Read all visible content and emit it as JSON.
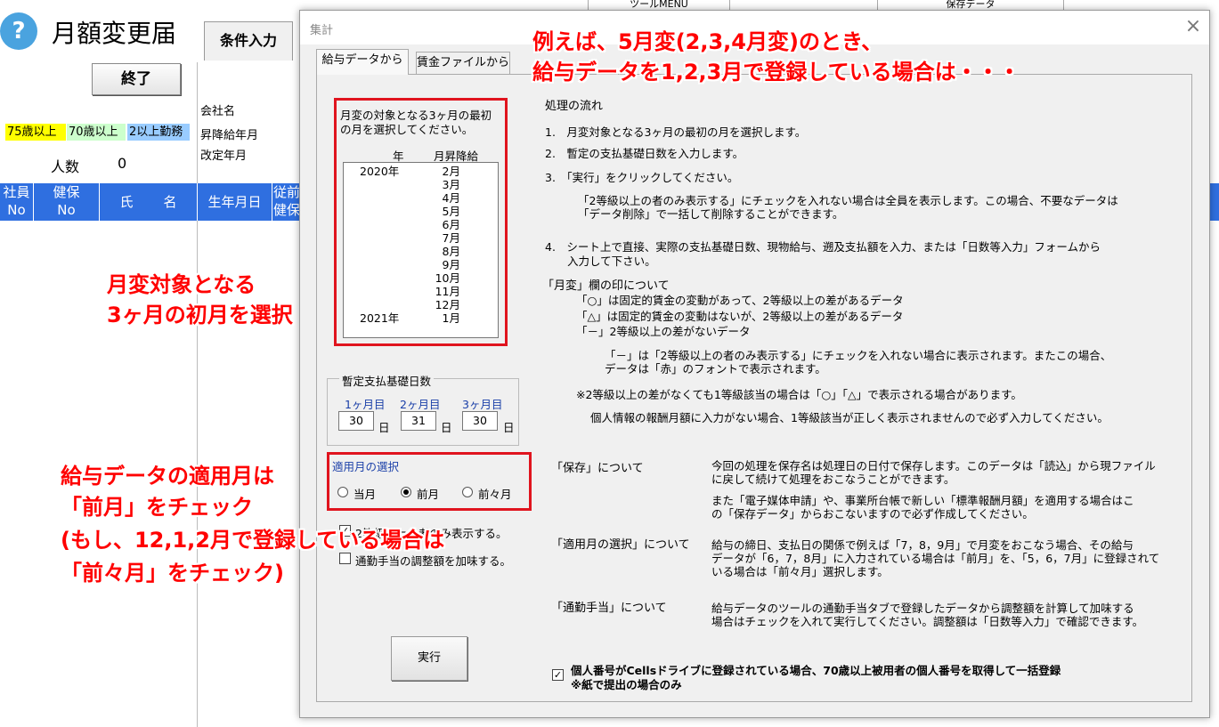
{
  "background": {
    "title": "月額変更届",
    "help_icon": "?",
    "end_button": "終了",
    "tab_condition": "条件入力",
    "top_tab_left": "ツールMENU",
    "top_tab_right": "保存データ",
    "company_label": "会社名",
    "raise_label": "昇降給年月",
    "revision_label": "改定年月",
    "badge_75": "75歳以上",
    "badge_70": "70歳以上",
    "badge_2": "2以上勤務",
    "count_label": "人数",
    "count_value": "0",
    "headers": [
      "社員",
      "No",
      "健保",
      "No",
      "氏",
      "名",
      "生年月日",
      "従前",
      "健保"
    ],
    "colors": {
      "header_bg": "#2f6fe0",
      "badge_75": "#ffff00",
      "badge_70": "#ccffcc",
      "badge_2": "#99ccff"
    }
  },
  "dialog": {
    "title": "集計",
    "close_icon": "×",
    "tabs": [
      "給与データから",
      "賃金ファイルから"
    ],
    "month_prompt": "月変の対象となる3ヶ月の最初の月を選択してください。",
    "col_year": "年",
    "col_month": "月昇降給",
    "month_list": [
      {
        "year": "2020年",
        "month": "2月"
      },
      {
        "year": "",
        "month": "3月"
      },
      {
        "year": "",
        "month": "4月"
      },
      {
        "year": "",
        "month": "5月"
      },
      {
        "year": "",
        "month": "6月"
      },
      {
        "year": "",
        "month": "7月"
      },
      {
        "year": "",
        "month": "8月"
      },
      {
        "year": "",
        "month": "9月"
      },
      {
        "year": "",
        "month": "10月"
      },
      {
        "year": "",
        "month": "11月"
      },
      {
        "year": "",
        "month": "12月"
      },
      {
        "year": "2021年",
        "month": "1月"
      }
    ],
    "days_group": "暫定支払基礎日数",
    "day_labels": [
      "1ヶ月目",
      "2ヶ月目",
      "3ヶ月目"
    ],
    "day_values": [
      "30",
      "31",
      "30"
    ],
    "day_unit": "日",
    "apply_title": "適用月の選択",
    "apply_options": [
      "当月",
      "前月",
      "前々月"
    ],
    "apply_selected": "前月",
    "check_grade2": "2等級以上の者のみ表示する。",
    "check_commute": "通勤手当の調整額を加味する。",
    "exec_button": "実行",
    "flow_title": "処理の流れ",
    "flow_1": "1.　月変対象となる3ヶ月の最初の月を選択します。",
    "flow_2": "2.　暫定の支払基礎日数を入力します。",
    "flow_3": "3.　「実行」をクリックしてください。",
    "flow_3_note_1": "「2等級以上の者のみ表示する」にチェックを入れない場合は全員を表示します。この場合、不要なデータは",
    "flow_3_note_2": "「データ削除」で一括して削除することができます。",
    "flow_4_1": "4.　シート上で直接、実際の支払基礎日数、現物給与、遡及支払額を入力、または「日数等入力」フォームから",
    "flow_4_2": "入力して下さい。",
    "mark_title": "「月変」欄の印について",
    "mark_1": "「○」は固定的賃金の変動があって、2等級以上の差があるデータ",
    "mark_2": "「△」は固定的賃金の変動はないが、2等級以上の差があるデータ",
    "mark_3": "「－」2等級以上の差がないデータ",
    "mark_note_1": "「－」は「2等級以上の者のみ表示する」にチェックを入れない場合に表示されます。またこの場合、",
    "mark_note_2": "データは「赤」のフォントで表示されます。",
    "note_star": "※2等級以上の差がなくても1等級該当の場合は「○」「△」で表示される場合があります。",
    "note_personal": "個人情報の報酬月額に入力がない場合、1等級該当が正しく表示されませんので必ず入力してください。",
    "save_label": "「保存」について",
    "save_1": "今回の処理を保存名は処理日の日付で保存します。このデータは「読込」から現ファイル",
    "save_2": "に戻して続けて処理をおこなうことができます。",
    "save_3": "また「電子媒体申請」や、事業所台帳で新しい「標準報酬月額」を適用する場合はこ",
    "save_4": "の「保存データ」からおこないますので必ず作成してください。",
    "apply_label": "「適用月の選択」について",
    "apply_1": "給与の締日、支払日の関係で例えば「7，8，9月」で月変をおこなう場合、その給与",
    "apply_2": "データが「6，7，8月」に入力されている場合は「前月」を、「5，6，7月」に登録されて",
    "apply_3": "いる場合は「前々月」選択します。",
    "commute_label": "「通勤手当」について",
    "commute_1": "給与データのツールの通勤手当タブで登録したデータから調整額を計算して加味する",
    "commute_2": "場合はチェックを入れて実行してください。調整額は「日数等入力」で確認できます。",
    "cells_line_1": "個人番号がCellsドライブに登録されている場合、70歳以上被用者の個人番号を取得して一括登録",
    "cells_line_2": "※紙で提出の場合のみ"
  },
  "annotations": {
    "top_1": "例えば、5月変(2,3,4月変)のとき、",
    "top_2": "給与データを1,2,3月で登録している場合は・・・",
    "left_1": "月変対象となる",
    "left_2": "3ヶ月の初月を選択",
    "bottom_1": "給与データの適用月は",
    "bottom_2": "「前月」をチェック",
    "bottom_3": "(もし、12,1,2月で登録している場合は",
    "bottom_4": "「前々月」をチェック)",
    "color": "#ff0000"
  }
}
